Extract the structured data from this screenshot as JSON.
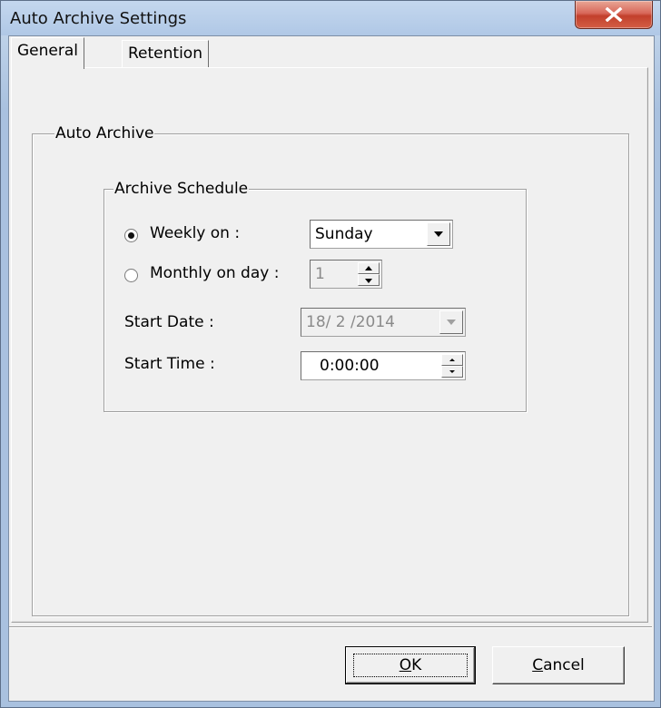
{
  "window": {
    "title": "Auto Archive Settings"
  },
  "tabs": [
    {
      "label": "General",
      "active": true
    },
    {
      "label": "Retention",
      "active": false
    }
  ],
  "auto_archive": {
    "group_label": "Auto Archive",
    "schedule": {
      "group_label": "Archive Schedule",
      "weekly_label": "Weekly on :",
      "weekly_selected": true,
      "weekly_value": "Sunday",
      "monthly_label": "Monthly on day :",
      "monthly_selected": false,
      "monthly_value": "1",
      "start_date_label": "Start Date :",
      "start_date_value": "18/ 2 /2014",
      "start_time_label": "Start Time :",
      "start_time_value": "0:00:00"
    }
  },
  "buttons": {
    "ok_mnemonic": "O",
    "ok_rest": "K",
    "cancel_mnemonic": "C",
    "cancel_rest": "ancel"
  },
  "icons": {
    "close": "close-icon",
    "dropdown": "chevron-down-icon",
    "spin": "spinner-arrows-icon"
  },
  "colors": {
    "close_button": "#c9473a",
    "titlebar": "#b8cde6",
    "dialog_face": "#f0f0f0"
  }
}
